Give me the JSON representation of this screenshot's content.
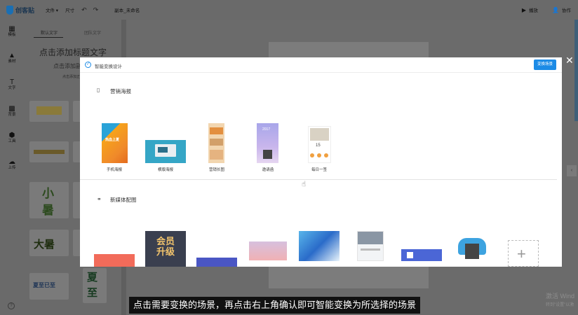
{
  "app": {
    "logo_text": "创客贴"
  },
  "topbar": {
    "menu_file": "文件 ▾",
    "menu_size": "尺寸",
    "undo_icon": "↶",
    "redo_icon": "↷",
    "doc_name": "副本_未命名",
    "play_icon": "▶",
    "play_label": "播放",
    "collab_icon": "👤",
    "collab_label": "协作"
  },
  "rail": {
    "items": [
      {
        "icon": "▦",
        "label": "模板"
      },
      {
        "icon": "▲",
        "label": "素材"
      },
      {
        "icon": "T",
        "label": "文字"
      },
      {
        "icon": "▩",
        "label": "背景"
      },
      {
        "icon": "⬢",
        "label": "工具"
      },
      {
        "icon": "☁",
        "label": "上传"
      }
    ],
    "help": "?"
  },
  "panel": {
    "tab_default": "默认文字",
    "tab_group": "团队文字",
    "add_title": "点击添加标题文字",
    "add_subtitle": "点击添加副标题",
    "add_body": "点击添加正文",
    "tiles": [
      "小",
      "暑",
      "大暑",
      "夏至已至",
      "夏",
      "至"
    ]
  },
  "modal": {
    "title": "智能变换设计",
    "check_icon": "✓",
    "switch_button": "变换场景",
    "close": "✕",
    "section1": {
      "icon": "▯",
      "title": "营销海报"
    },
    "section1_items": [
      {
        "label": "手机海报",
        "thumb_text": "热血上夏"
      },
      {
        "label": "横版海报",
        "thumb_text": ""
      },
      {
        "label": "营销长图",
        "thumb_text": ""
      },
      {
        "label": "邀请函",
        "thumb_text": "2017"
      },
      {
        "label": "每日一签",
        "thumb_text": "15"
      }
    ],
    "section2": {
      "icon": "⚭",
      "title": "新媒体配图"
    },
    "section2_items": [
      {
        "thumb_text": ""
      },
      {
        "thumb_text": "会员升级"
      },
      {
        "thumb_text": ""
      },
      {
        "thumb_text": ""
      },
      {
        "thumb_text": ""
      },
      {
        "thumb_text": ""
      },
      {
        "thumb_text": ""
      },
      {
        "thumb_text": ""
      },
      {
        "thumb_text": "+"
      }
    ]
  },
  "subtitle": "点击需要变换的场景，再点击右上角确认即可智能变换为所选择的场景",
  "watermark": {
    "line1": "激活 Wind",
    "line2": "转到\"设置\"以激"
  },
  "side_arrow": "‹"
}
